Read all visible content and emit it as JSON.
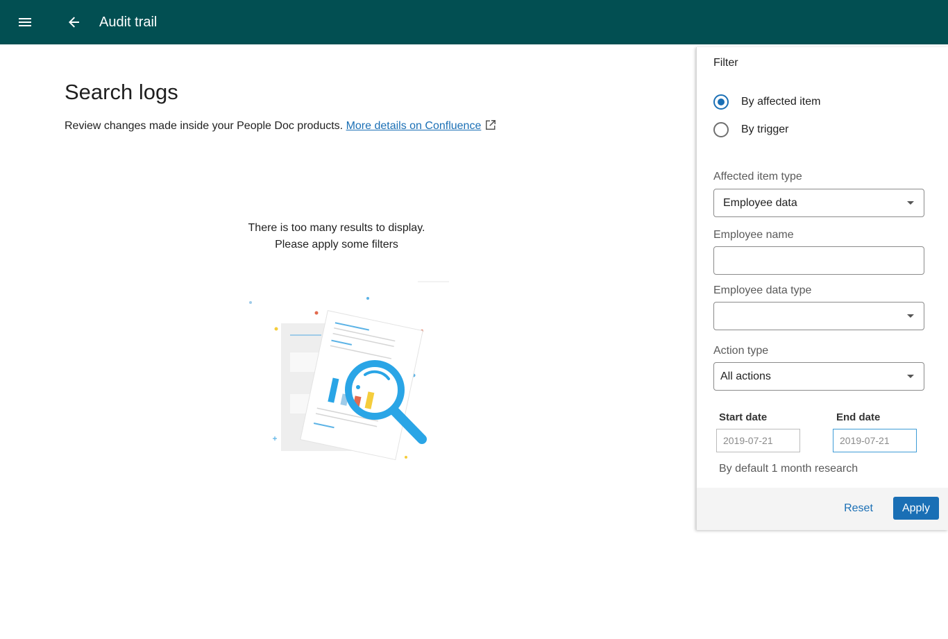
{
  "appbar": {
    "title": "Audit trail",
    "menu_icon": "hamburger-menu-icon",
    "back_icon": "arrow-left-icon",
    "background_color": "#024f52"
  },
  "main": {
    "title": "Search logs",
    "description": "Review changes made inside your People Doc products.",
    "link_text": "More details on Confluence",
    "link_icon": "external-link-icon",
    "empty_line_1": "There is too many results to display.",
    "empty_line_2": "Please apply some filters"
  },
  "filter": {
    "title": "Filter",
    "radios": [
      {
        "label": "By affected item",
        "checked": true
      },
      {
        "label": "By trigger",
        "checked": false
      }
    ],
    "affected_item_type": {
      "label": "Affected item type",
      "value": "Employee data"
    },
    "employee_name": {
      "label": "Employee name",
      "value": ""
    },
    "employee_data_type": {
      "label": "Employee data type",
      "value": ""
    },
    "action_type": {
      "label": "Action type",
      "value": "All actions"
    },
    "start_date": {
      "label": "Start date",
      "value": "2019-07-21"
    },
    "end_date": {
      "label": "End date",
      "value": "2019-07-21"
    },
    "date_hint": "By default 1 month research",
    "reset_label": "Reset",
    "apply_label": "Apply",
    "accent_color": "#1a6fb5"
  }
}
